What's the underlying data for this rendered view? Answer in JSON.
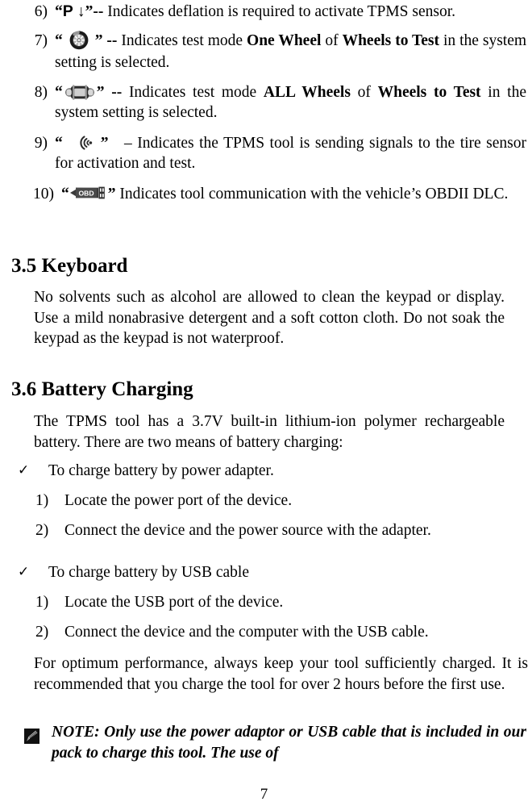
{
  "document": {
    "page_number": "7",
    "symbol_list": [
      {
        "number": "6)",
        "symbol_text": "P ↓",
        "symbol_kind": "text",
        "dash": "--",
        "description": "Indicates deflation is required to activate TPMS sensor.",
        "segments": [
          {
            "text": "“",
            "style": "bold"
          },
          {
            "text": "P ↓",
            "style": "bold-sans"
          },
          {
            "text": "”",
            "style": "bold"
          },
          {
            "text": "--",
            "style": "bold"
          },
          {
            "text": " Indicates deflation is required to activate TPMS sensor.",
            "style": "normal"
          }
        ]
      },
      {
        "number": "7)",
        "symbol_kind": "wheel-icon",
        "dash": "--",
        "description": "Indicates test mode One Wheel of Wheels to Test in the system setting is selected.",
        "segments": [
          {
            "text": "“",
            "style": "bold"
          },
          {
            "text": "[wheel-icon]",
            "style": "icon"
          },
          {
            "text": "”",
            "style": "bold"
          },
          {
            "text": " -- ",
            "style": "bold"
          },
          {
            "text": "Indicates test mode ",
            "style": "normal"
          },
          {
            "text": "One Wheel",
            "style": "bold"
          },
          {
            "text": " of ",
            "style": "normal"
          },
          {
            "text": "Wheels to Test",
            "style": "bold"
          },
          {
            "text": " in the system setting is selected.",
            "style": "normal"
          }
        ]
      },
      {
        "number": "8)",
        "symbol_kind": "car-icon",
        "dash": "--",
        "description": "Indicates test mode ALL Wheels of Wheels to Test in the system setting is selected.",
        "segments": [
          {
            "text": "“",
            "style": "bold"
          },
          {
            "text": "[car-icon]",
            "style": "icon"
          },
          {
            "text": "”",
            "style": "bold"
          },
          {
            "text": " -- ",
            "style": "bold"
          },
          {
            "text": "Indicates test mode ",
            "style": "normal"
          },
          {
            "text": "ALL Wheels",
            "style": "bold"
          },
          {
            "text": " of ",
            "style": "normal"
          },
          {
            "text": "Wheels to Test",
            "style": "bold"
          },
          {
            "text": " in the system setting is selected.",
            "style": "normal"
          }
        ]
      },
      {
        "number": "9)",
        "symbol_kind": "signal-icon",
        "dash": "–",
        "description": "Indicates the TPMS tool is sending signals to the tire sensor for activation and test.",
        "segments": [
          {
            "text": "“",
            "style": "bold"
          },
          {
            "text": "[signal-icon]",
            "style": "icon"
          },
          {
            "text": "”",
            "style": "bold"
          },
          {
            "text": "  – Indicates the TPMS tool is sending signals to the tire sensor for activation and test.",
            "style": "normal"
          }
        ]
      },
      {
        "number": "10)",
        "symbol_kind": "obd-icon",
        "dash": "–",
        "description": "Indicates tool communication with the vehicle’s OBDII DLC.",
        "segments": [
          {
            "text": "“",
            "style": "bold"
          },
          {
            "text": "[obd-icon]",
            "style": "icon"
          },
          {
            "text": "”",
            "style": "bold"
          },
          {
            "text": " – Indicates tool communication with the vehicle’s OBDII DLC.",
            "style": "normal"
          }
        ]
      }
    ],
    "section_keyboard": {
      "heading": "3.5 Keyboard",
      "paragraph": "No solvents such as alcohol are allowed to clean the keypad or display. Use a mild nonabrasive detergent and a soft cotton cloth. Do not soak the keypad as the keypad is not waterproof."
    },
    "section_battery": {
      "heading": "3.6 Battery Charging",
      "intro": "The TPMS tool has a 3.7V built-in lithium-ion polymer rechargeable battery. There are two means of battery charging:",
      "methods": [
        {
          "check": "✓",
          "title": "To charge battery by power adapter.",
          "steps": [
            {
              "number": "1)",
              "text": "Locate the power port of the device."
            },
            {
              "number": "2)",
              "text": "Connect the device and the power source with the adapter."
            }
          ]
        },
        {
          "check": "✓",
          "title": "To charge battery by USB cable",
          "steps": [
            {
              "number": "1)",
              "text": "Locate the USB port of the device."
            },
            {
              "number": "2)",
              "text": "Connect the device and the computer with the USB cable."
            }
          ]
        }
      ],
      "closing": "For optimum performance, always keep your tool sufficiently charged. It is recommended that you charge the tool for over 2 hours before the first use.",
      "note": {
        "icon": "note-pencil-icon",
        "text": "NOTE: Only use the power adaptor or USB cable that is included in our pack to charge this tool. The use of"
      }
    }
  }
}
